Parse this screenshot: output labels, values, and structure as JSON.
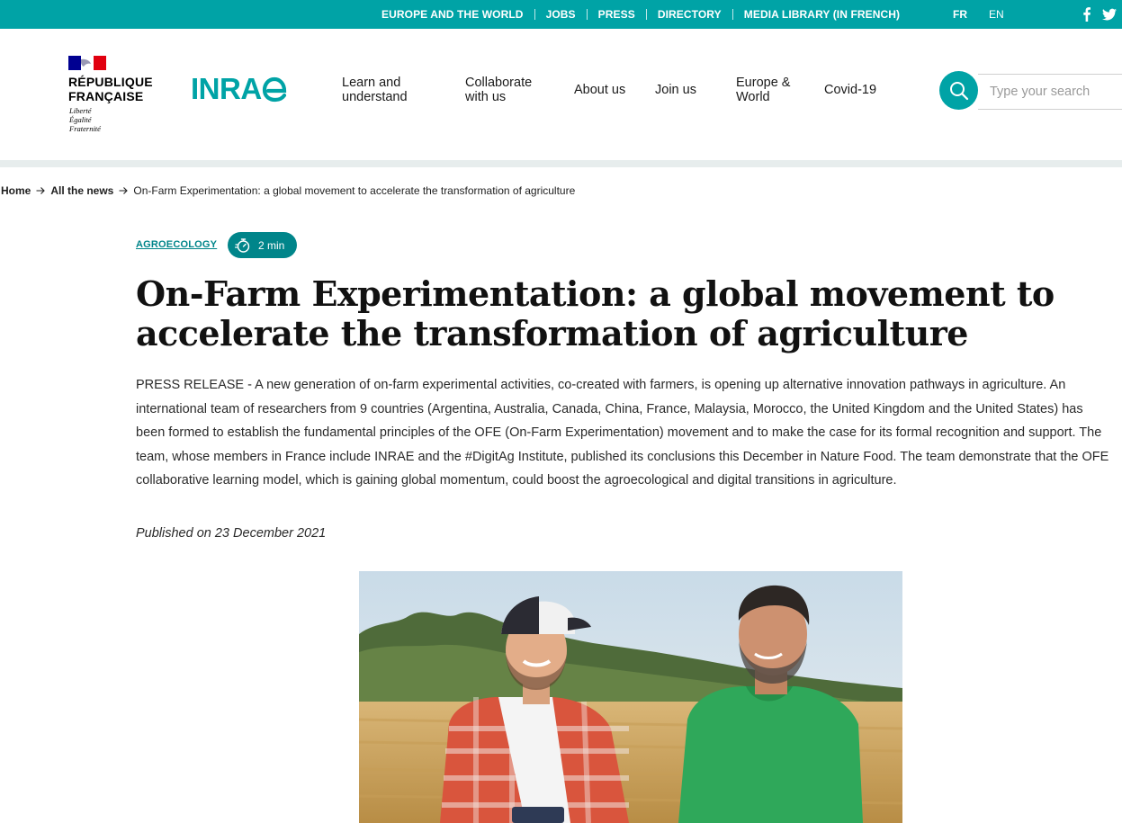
{
  "topbar": {
    "links": [
      "EUROPE AND THE WORLD",
      "JOBS",
      "PRESS",
      "DIRECTORY",
      "MEDIA LIBRARY (IN FRENCH)"
    ],
    "lang_fr": "FR",
    "lang_en": "EN",
    "social": [
      "facebook-icon",
      "twitter-icon"
    ]
  },
  "header": {
    "rf_title": "RÉPUBLIQUE\nFRANÇAISE",
    "rf_motto": "Liberté\nÉgalité\nFraternité",
    "logo_text": "INRAE",
    "nav": [
      "Learn and\nunderstand",
      "Collaborate\nwith us",
      "About us",
      "Join us",
      "Europe &\nWorld",
      "Covid-19"
    ],
    "search_placeholder": "Type your search"
  },
  "breadcrumb": {
    "home": "Home",
    "news": "All the news",
    "current": "On-Farm Experimentation: a global movement to accelerate the transformation of agriculture"
  },
  "article": {
    "category": "AGROECOLOGY",
    "read_time": "2 min",
    "title": "On-Farm Experimentation: a global movement to accelerate the transformation of agriculture",
    "chapo": "PRESS RELEASE - A new generation of on-farm experimental activities, co-created with farmers, is opening up alternative innovation pathways in agriculture. An international team of researchers from 9 countries (Argentina, Australia, Canada, China, France, Malaysia, Morocco, the United Kingdom and the United States) has been formed to establish the fundamental principles of the OFE (On-Farm Experimentation) movement and to make the case for its formal recognition and support. The team, whose members in France include INRAE and the #DigitAg Institute, published its conclusions this December in Nature Food. The team demonstrate that the OFE collaborative learning model, which is gaining global momentum, could boost the agroecological and digital transitions in agriculture.",
    "published": "Published on 23 December 2021"
  },
  "colors": {
    "brand_teal": "#00a3a6",
    "tag_teal": "#00858a",
    "header_rule": "#e7eded"
  }
}
